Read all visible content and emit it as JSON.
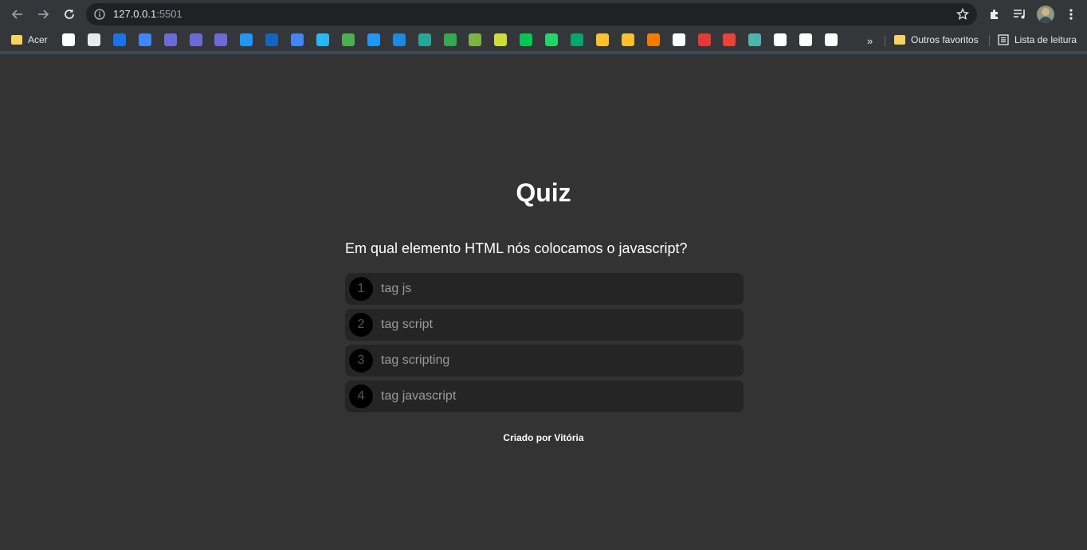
{
  "browser": {
    "url_host": "127.0.0.1",
    "url_port": ":5501",
    "bookmarks": [
      {
        "label": "Acer",
        "icon": "folder-icon",
        "color": "#f4d35e"
      },
      {
        "label": "",
        "icon": "google-icon",
        "color": "#ffffff"
      },
      {
        "label": "",
        "icon": "numbers-icon",
        "color": "#e9e9e9"
      },
      {
        "label": "",
        "icon": "s-app-icon",
        "color": "#1a73e8"
      },
      {
        "label": "",
        "icon": "gs-icon",
        "color": "#4285f4"
      },
      {
        "label": "",
        "icon": "grid-icon",
        "color": "#6b6bd6"
      },
      {
        "label": "",
        "icon": "grid-icon",
        "color": "#6b6bd6"
      },
      {
        "label": "",
        "icon": "grid-icon",
        "color": "#6b6bd6"
      },
      {
        "label": "",
        "icon": "funnel-icon",
        "color": "#2196f3"
      },
      {
        "label": "",
        "icon": "globe-icon",
        "color": "#1565c0"
      },
      {
        "label": "",
        "icon": "translate-icon",
        "color": "#4285f4"
      },
      {
        "label": "",
        "icon": "circle-app-icon",
        "color": "#29b6f6"
      },
      {
        "label": "",
        "icon": "photo-icon",
        "color": "#4caf50"
      },
      {
        "label": "",
        "icon": "window-icon",
        "color": "#2196f3"
      },
      {
        "label": "",
        "icon": "mb-icon",
        "color": "#1e88e5"
      },
      {
        "label": "",
        "icon": "cube-icon",
        "color": "#26a69a"
      },
      {
        "label": "",
        "icon": "meet-icon",
        "color": "#34a853"
      },
      {
        "label": "",
        "icon": "x-circle-icon",
        "color": "#7cb342"
      },
      {
        "label": "",
        "icon": "ring-icon",
        "color": "#cddc39"
      },
      {
        "label": "",
        "icon": "green-dot-icon",
        "color": "#00c853"
      },
      {
        "label": "",
        "icon": "whatsapp-icon",
        "color": "#25d366"
      },
      {
        "label": "",
        "icon": "w-icon",
        "color": "#00a86b"
      },
      {
        "label": "",
        "icon": "classroom-icon",
        "color": "#fbc02d"
      },
      {
        "label": "",
        "icon": "keep-icon",
        "color": "#fbc02d"
      },
      {
        "label": "",
        "icon": "in-icon",
        "color": "#f57c00"
      },
      {
        "label": "",
        "icon": "l-icon",
        "color": "#ffffff"
      },
      {
        "label": "",
        "icon": "lips-icon",
        "color": "#e53935"
      },
      {
        "label": "",
        "icon": "gmail-icon",
        "color": "#ea4335"
      },
      {
        "label": "",
        "icon": "edge-icon",
        "color": "#4db6ac"
      },
      {
        "label": "",
        "icon": "github-icon",
        "color": "#ffffff"
      },
      {
        "label": "",
        "icon": "l-icon",
        "color": "#ffffff"
      },
      {
        "label": "",
        "icon": "l-icon",
        "color": "#ffffff"
      }
    ],
    "more_bookmarks": "»",
    "other_favorites": "Outros favoritos",
    "reading_list": "Lista de leitura"
  },
  "quiz": {
    "title": "Quiz",
    "question": "Em qual elemento HTML nós colocamos o javascript?",
    "options": [
      {
        "number": "1",
        "label": "tag js"
      },
      {
        "number": "2",
        "label": "tag script"
      },
      {
        "number": "3",
        "label": "tag scripting"
      },
      {
        "number": "4",
        "label": "tag javascript"
      }
    ],
    "footer": "Criado por Vitória"
  },
  "colors": {
    "page_background": "#333333",
    "option_background": "#252525",
    "number_circle": "#000000",
    "title_text": "#ffffff"
  }
}
